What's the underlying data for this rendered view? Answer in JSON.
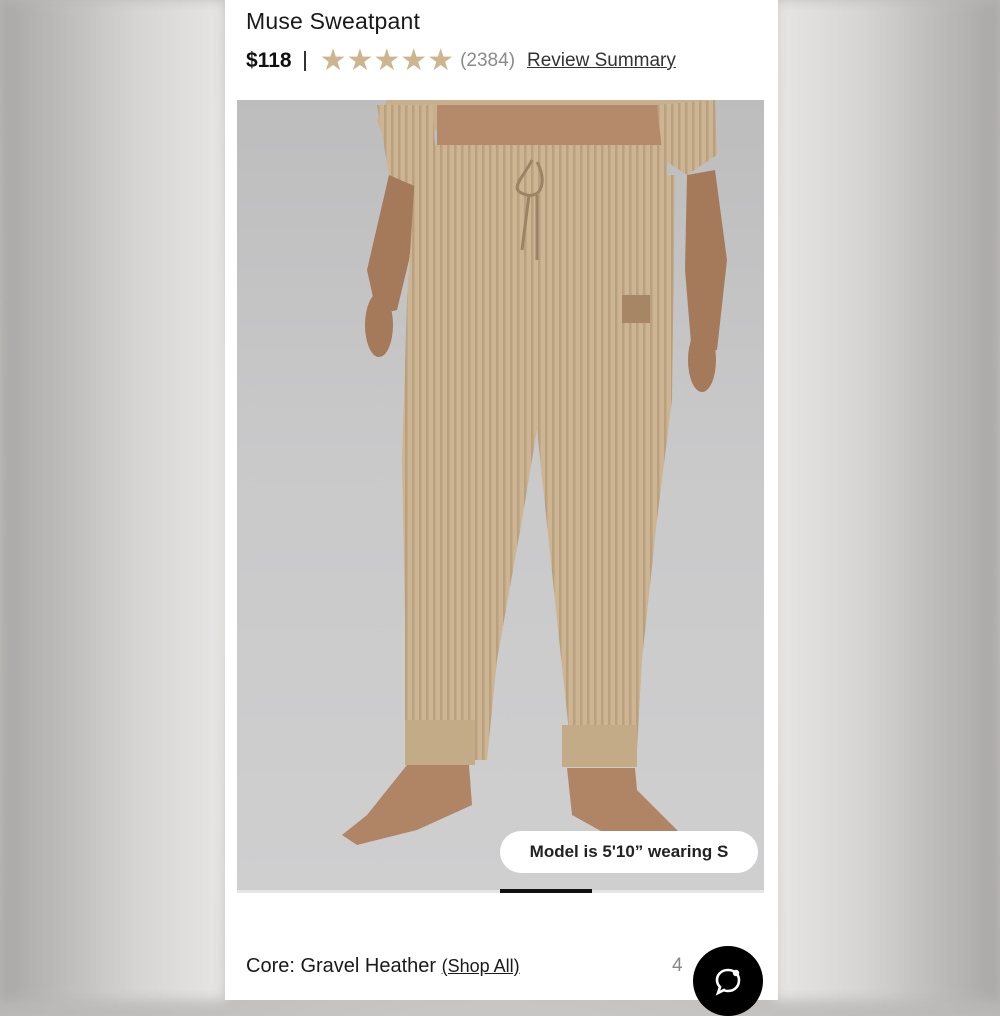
{
  "product": {
    "title": "Muse Sweatpant",
    "price": "$118",
    "rating_stars": 5,
    "review_count": "(2384)",
    "review_link_label": "Review Summary"
  },
  "gallery": {
    "model_note": "Model is 5'10” wearing S",
    "slide_progress": 0.2
  },
  "color": {
    "label": "Core: Gravel Heather",
    "shop_all_label": "(Shop All)",
    "count_fragment": "4"
  },
  "icons": {
    "star": "star-icon",
    "chat": "chat-bubble-icon"
  },
  "colors": {
    "star": "#cdb590",
    "pant": "#cbb392",
    "background": "#c9c9ca"
  }
}
